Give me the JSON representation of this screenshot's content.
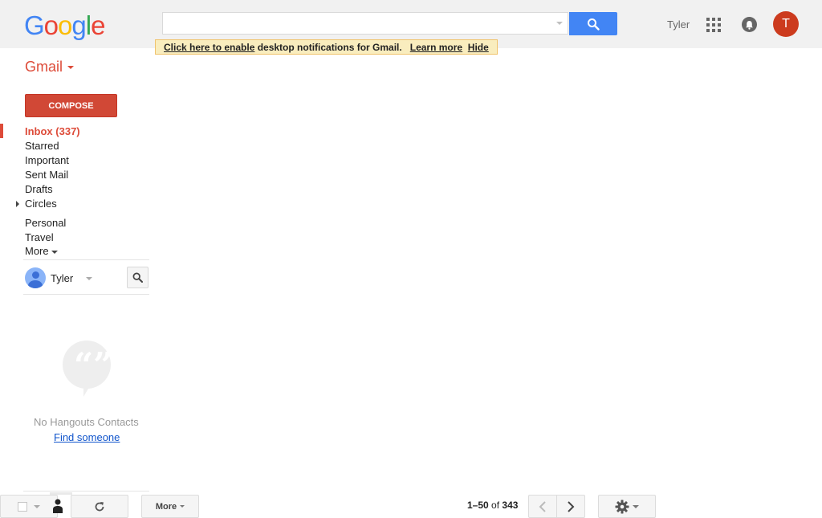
{
  "header": {
    "logo_letters": [
      {
        "ch": "G",
        "color": "#4285f4"
      },
      {
        "ch": "o",
        "color": "#ea4335"
      },
      {
        "ch": "o",
        "color": "#fbbc05"
      },
      {
        "ch": "g",
        "color": "#4285f4"
      },
      {
        "ch": "l",
        "color": "#34a853"
      },
      {
        "ch": "e",
        "color": "#ea4335"
      }
    ],
    "search_value": "",
    "user_name": "Tyler",
    "avatar_initial": "T",
    "icons": {
      "search": "search-icon",
      "apps": "apps-grid-icon",
      "notifications": "bell-icon"
    }
  },
  "notification": {
    "enable_link": "Click here to enable",
    "message": " desktop notifications for Gmail.",
    "learn_more": "Learn more",
    "hide": "Hide"
  },
  "nav": {
    "app_label": "Gmail",
    "compose": "COMPOSE",
    "items": [
      {
        "label": "Inbox (337)",
        "active": true
      },
      {
        "label": "Starred"
      },
      {
        "label": "Important"
      },
      {
        "label": "Sent Mail"
      },
      {
        "label": "Drafts"
      },
      {
        "label": "Circles"
      },
      {
        "label": "Personal"
      },
      {
        "label": "Travel"
      },
      {
        "label": "More"
      }
    ]
  },
  "hangouts": {
    "user_name": "Tyler",
    "empty_message": "No Hangouts Contacts",
    "find_link": "Find someone",
    "quote_marks": "“”"
  },
  "toolbar": {
    "more_label": "More",
    "pager_range": "1–50",
    "pager_of": "of",
    "pager_total": "343"
  },
  "colors": {
    "accent": "#dd4b39",
    "search_button": "#4285f4",
    "compose": "#d14836",
    "avatar": "#cc3b1e",
    "link": "#1155cc"
  }
}
